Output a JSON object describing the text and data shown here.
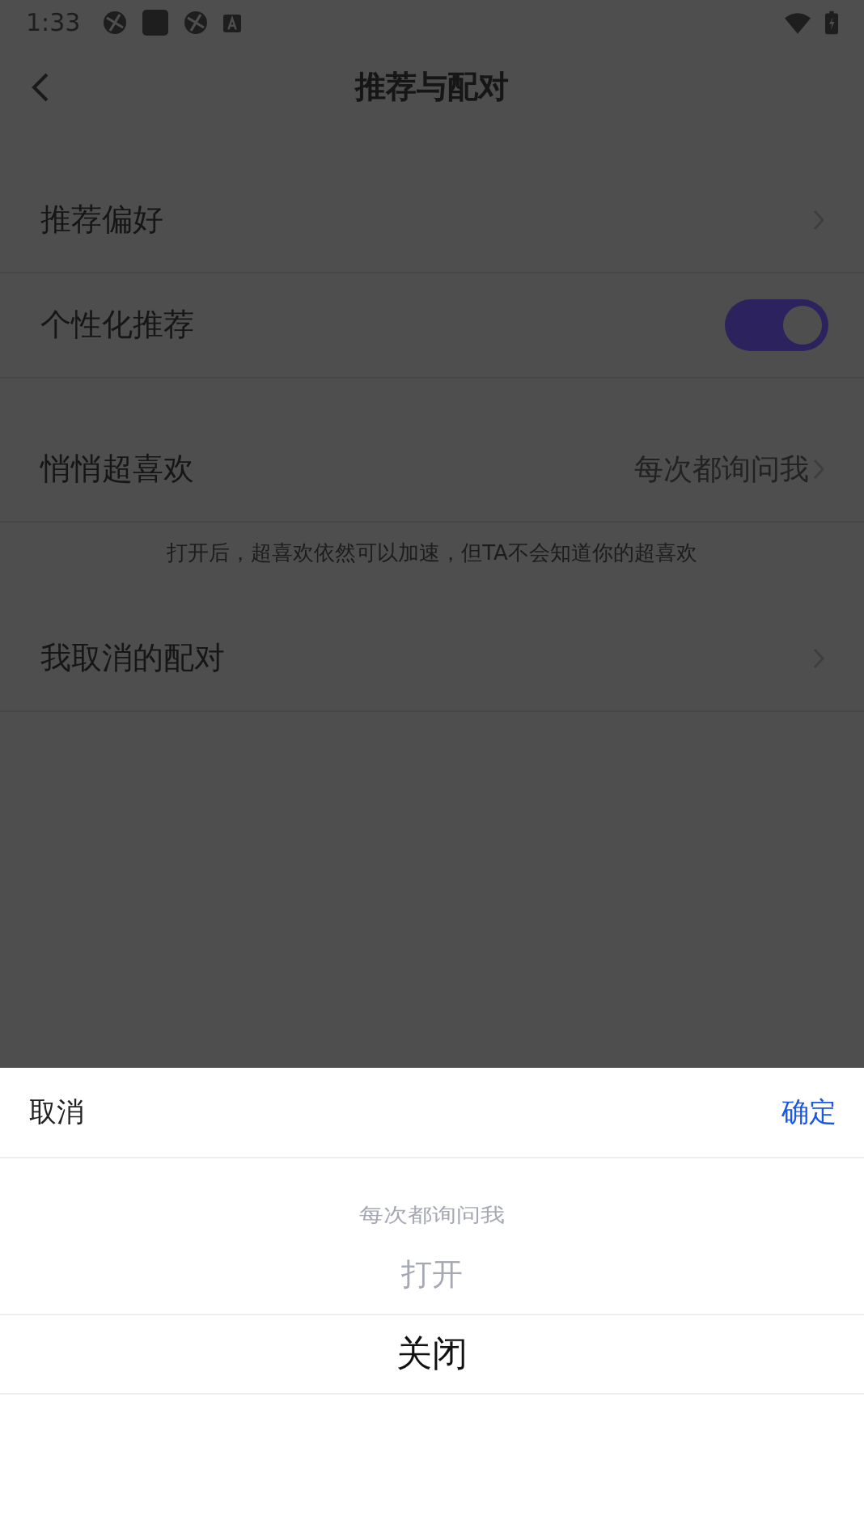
{
  "status_bar": {
    "time": "1:33"
  },
  "header": {
    "title": "推荐与配对"
  },
  "sections": [
    {
      "items": [
        {
          "kind": "link",
          "label": "推荐偏好"
        },
        {
          "kind": "toggle",
          "label": "个性化推荐",
          "on": true
        }
      ]
    },
    {
      "items": [
        {
          "kind": "link",
          "label": "悄悄超喜欢",
          "value": "每次都询问我",
          "note": "打开后，超喜欢依然可以加速，但TA不会知道你的超喜欢"
        },
        {
          "kind": "link",
          "label": "我取消的配对"
        }
      ]
    }
  ],
  "sheet": {
    "cancel": "取消",
    "confirm": "确定",
    "options": [
      {
        "label": "每次都询问我",
        "selected": false
      },
      {
        "label": "打开",
        "selected": false
      },
      {
        "label": "关闭",
        "selected": true
      }
    ]
  }
}
